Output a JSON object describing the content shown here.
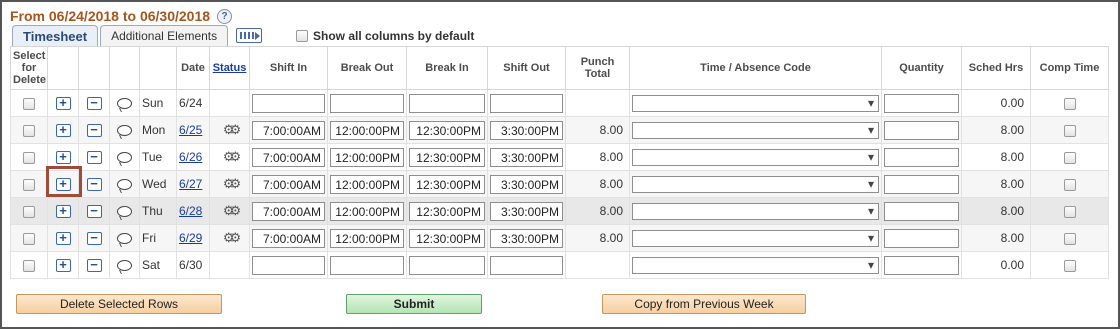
{
  "header": {
    "period_title": "From 06/24/2018 to 06/30/2018",
    "help_glyph": "?"
  },
  "tabs": [
    {
      "label": "Timesheet",
      "active": true
    },
    {
      "label": "Additional Elements",
      "active": false
    }
  ],
  "show_all_columns": {
    "label": "Show all columns by default",
    "checked": false
  },
  "columns": {
    "select_for_delete": "Select for Delete",
    "date": "Date",
    "status": "Status",
    "shift_in": "Shift In",
    "break_out": "Break Out",
    "break_in": "Break In",
    "shift_out": "Shift Out",
    "punch_total": "Punch Total",
    "time_absence_code": "Time / Absence Code",
    "quantity": "Quantity",
    "sched_hrs": "Sched Hrs",
    "comp_time": "Comp Time"
  },
  "rows": [
    {
      "day": "Sun",
      "date": "6/24",
      "date_link": false,
      "status": false,
      "shift_in": "",
      "break_out": "",
      "break_in": "",
      "shift_out": "",
      "punch_total": "",
      "quantity": "",
      "sched_hrs": "0.00"
    },
    {
      "day": "Mon",
      "date": "6/25",
      "date_link": true,
      "status": true,
      "shift_in": "7:00:00AM",
      "break_out": "12:00:00PM",
      "break_in": "12:30:00PM",
      "shift_out": "3:30:00PM",
      "punch_total": "8.00",
      "quantity": "",
      "sched_hrs": "8.00"
    },
    {
      "day": "Tue",
      "date": "6/26",
      "date_link": true,
      "status": true,
      "shift_in": "7:00:00AM",
      "break_out": "12:00:00PM",
      "break_in": "12:30:00PM",
      "shift_out": "3:30:00PM",
      "punch_total": "8.00",
      "quantity": "",
      "sched_hrs": "8.00"
    },
    {
      "day": "Wed",
      "date": "6/27",
      "date_link": true,
      "status": true,
      "shift_in": "7:00:00AM",
      "break_out": "12:00:00PM",
      "break_in": "12:30:00PM",
      "shift_out": "3:30:00PM",
      "punch_total": "8.00",
      "quantity": "",
      "sched_hrs": "8.00"
    },
    {
      "day": "Thu",
      "date": "6/28",
      "date_link": true,
      "status": true,
      "shift_in": "7:00:00AM",
      "break_out": "12:00:00PM",
      "break_in": "12:30:00PM",
      "shift_out": "3:30:00PM",
      "punch_total": "8.00",
      "quantity": "",
      "sched_hrs": "8.00"
    },
    {
      "day": "Fri",
      "date": "6/29",
      "date_link": true,
      "status": true,
      "shift_in": "7:00:00AM",
      "break_out": "12:00:00PM",
      "break_in": "12:30:00PM",
      "shift_out": "3:30:00PM",
      "punch_total": "8.00",
      "quantity": "",
      "sched_hrs": "8.00"
    },
    {
      "day": "Sat",
      "date": "6/30",
      "date_link": false,
      "status": false,
      "shift_in": "",
      "break_out": "",
      "break_in": "",
      "shift_out": "",
      "punch_total": "",
      "quantity": "",
      "sched_hrs": "0.00"
    }
  ],
  "icons": {
    "add": "+",
    "remove": "−",
    "status_gear": "⚙⚙"
  },
  "buttons": {
    "delete": "Delete Selected Rows",
    "submit": "Submit",
    "copy": "Copy from Previous Week"
  }
}
